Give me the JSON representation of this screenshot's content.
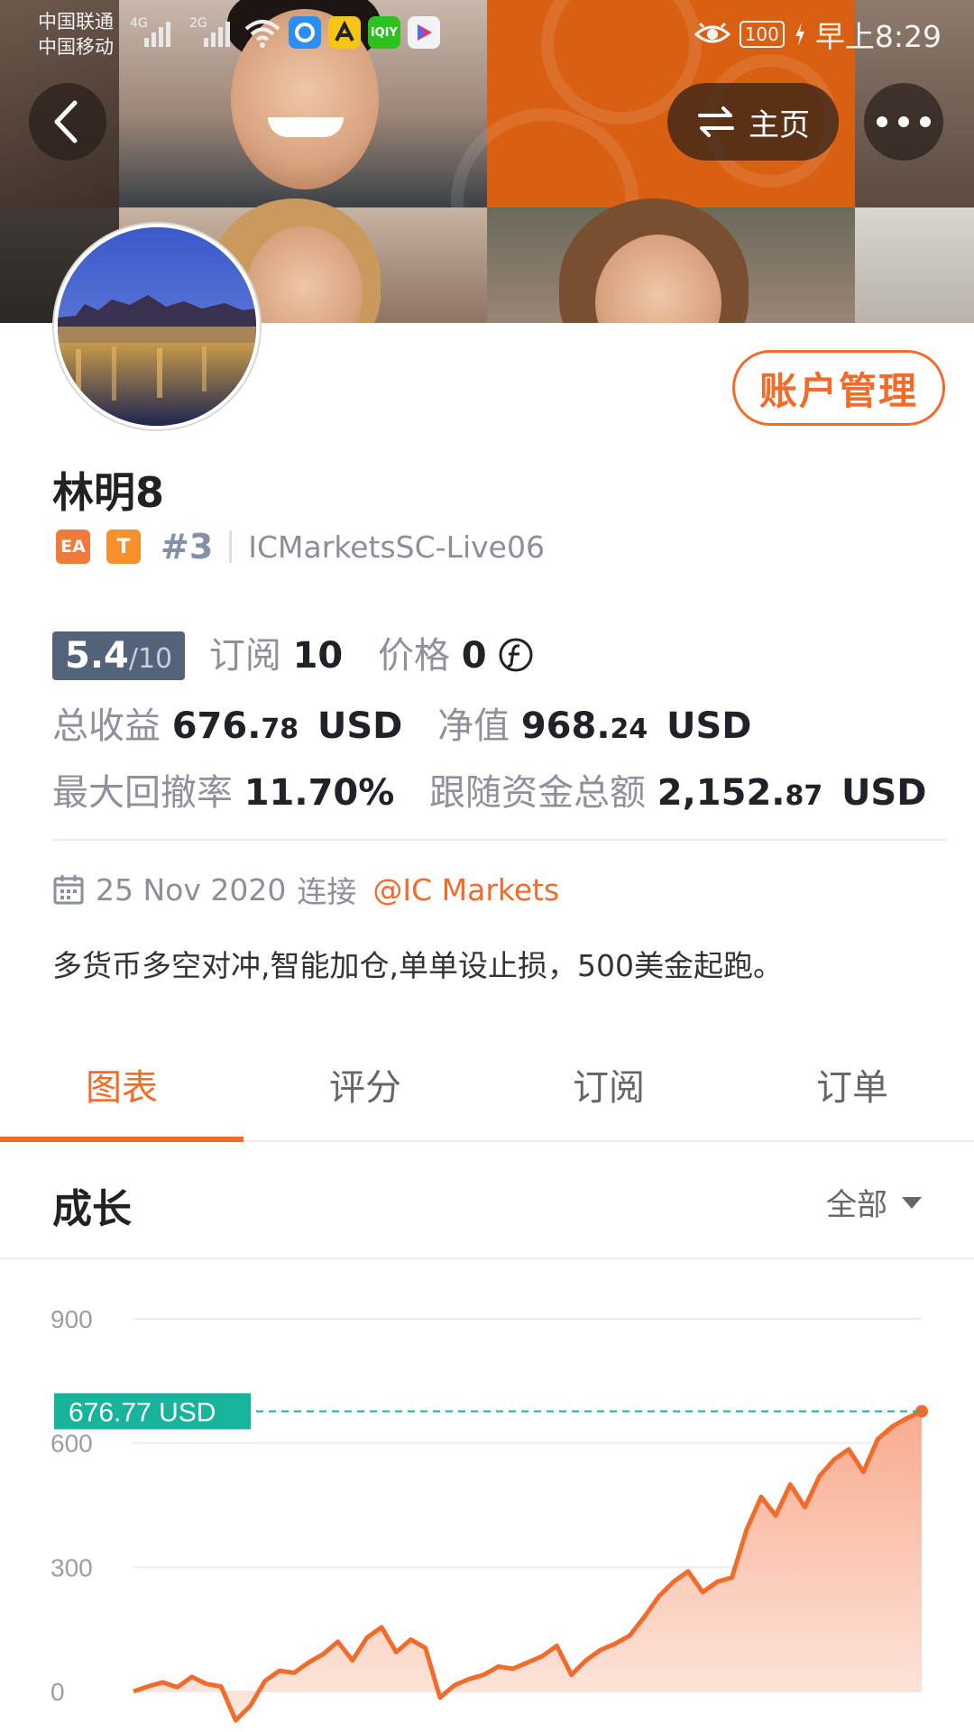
{
  "status_bar": {
    "carrier1": "中国联通",
    "carrier2": "中国移动",
    "net1": "4G",
    "net2": "2G",
    "battery": "100",
    "time": "早上8:29"
  },
  "nav": {
    "home_label": "主页"
  },
  "profile": {
    "name": "林明8",
    "badge_ea": "EA",
    "badge_t": "T",
    "rank": "#3",
    "server": "ICMarketsSC-Live06",
    "manage_button": "账户管理"
  },
  "stats": {
    "score": "5.4",
    "score_max": "/10",
    "subscribe_label": "订阅",
    "subscribe_value": "10",
    "price_label": "价格",
    "price_value": "0",
    "profit_label": "总收益",
    "profit_int": "676.",
    "profit_dec": "78",
    "profit_unit": "USD",
    "equity_label": "净值",
    "equity_int": "968.",
    "equity_dec": "24",
    "equity_unit": "USD",
    "drawdown_label": "最大回撤率",
    "drawdown_value": "11.70%",
    "follow_label": "跟随资金总额",
    "follow_int": "2,152.",
    "follow_dec": "87",
    "follow_unit": "USD"
  },
  "connection": {
    "date": "25 Nov 2020",
    "verb": "连接",
    "broker": "@IC Markets"
  },
  "description": "多货币多空对冲,智能加仓,单单设止损，500美金起跑。",
  "tabs": [
    {
      "label": "图表",
      "active": true
    },
    {
      "label": "评分",
      "active": false
    },
    {
      "label": "订阅",
      "active": false
    },
    {
      "label": "订单",
      "active": false
    }
  ],
  "section": {
    "title": "成长",
    "filter": "全部"
  },
  "colors": {
    "accent": "#f26b2a",
    "teal": "#17b39b",
    "score_bg": "#54627a"
  },
  "chart_data": {
    "type": "area",
    "title": "",
    "xlabel": "",
    "ylabel": "",
    "ylim": [
      0,
      900
    ],
    "yticks": [
      "900",
      "600",
      "300",
      "0"
    ],
    "current_label": "676.77 USD",
    "current_value": 676.77,
    "series": [
      {
        "values": [
          0,
          12,
          22,
          10,
          35,
          18,
          12,
          -70,
          -35,
          25,
          50,
          45,
          70,
          90,
          120,
          75,
          130,
          155,
          95,
          125,
          105,
          -15,
          15,
          30,
          40,
          60,
          55,
          70,
          85,
          110,
          40,
          75,
          100,
          115,
          135,
          180,
          230,
          265,
          290,
          240,
          265,
          275,
          390,
          470,
          425,
          500,
          445,
          520,
          560,
          585,
          530,
          610,
          640,
          660,
          676.77
        ]
      }
    ]
  }
}
